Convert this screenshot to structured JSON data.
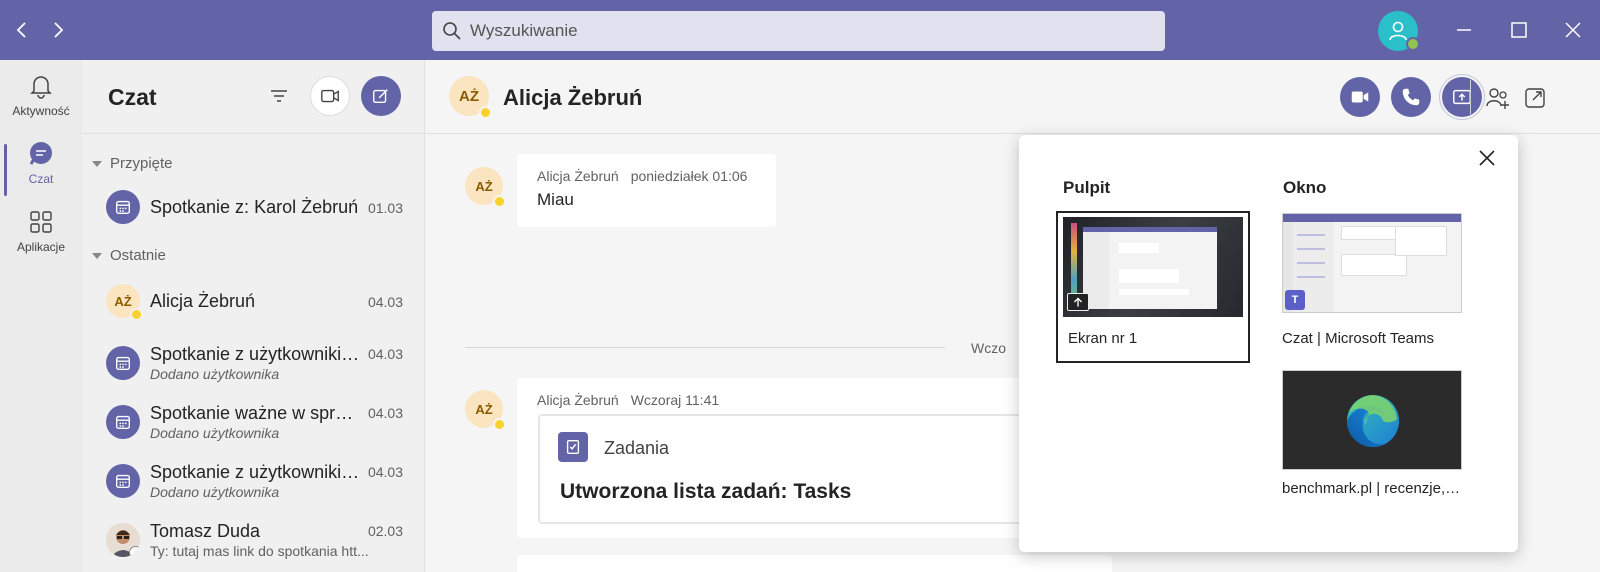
{
  "titlebar": {
    "search_placeholder": "Wyszukiwanie",
    "accent": "#6264a7"
  },
  "rail": {
    "items": [
      {
        "label": "Aktywność",
        "icon": "bell-icon"
      },
      {
        "label": "Czat",
        "icon": "chat-icon",
        "active": true
      },
      {
        "label": "Aplikacje",
        "icon": "apps-icon"
      }
    ]
  },
  "chatlist": {
    "title": "Czat",
    "sections": {
      "pinned": "Przypięte",
      "recent": "Ostatnie"
    },
    "pinned_items": [
      {
        "name": "Spotkanie z: Karol Żebruń",
        "date": "01.03"
      }
    ],
    "recent_items": [
      {
        "name": "Alicja Żebruń",
        "initials": "AŻ",
        "date": "04.03",
        "sub": ""
      },
      {
        "name": "Spotkanie z użytkownikiem",
        "date": "04.03",
        "sub": "Dodano użytkownika"
      },
      {
        "name": "Spotkanie ważne w sprawie",
        "date": "04.03",
        "sub": "Dodano użytkownika"
      },
      {
        "name": "Spotkanie z użytkownikiem",
        "date": "04.03",
        "sub": "Dodano użytkownika"
      },
      {
        "name": "Tomasz Duda",
        "date": "02.03",
        "sub": "Ty: tutaj mas link do spotkania htt..."
      }
    ]
  },
  "main": {
    "contact_initials": "AŻ",
    "contact_name": "Alicja Żebruń",
    "messages": [
      {
        "author": "Alicja Żebruń",
        "time": "poniedziałek 01:06",
        "text": "Miau"
      },
      {
        "author": "Alicja Żebruń",
        "time": "Wczoraj 11:41",
        "text": ""
      }
    ],
    "day_divider": "Wczo",
    "card": {
      "app": "Zadania",
      "title": "Utworzona lista zadań: Tasks"
    }
  },
  "share_popup": {
    "desktop_section": "Pulpit",
    "window_section": "Okno",
    "desktop_items": [
      {
        "caption": "Ekran nr 1",
        "selected": true
      }
    ],
    "window_items": [
      {
        "caption": "Czat | Microsoft Teams"
      },
      {
        "caption": "benchmark.pl | recenzje, t..."
      }
    ]
  }
}
